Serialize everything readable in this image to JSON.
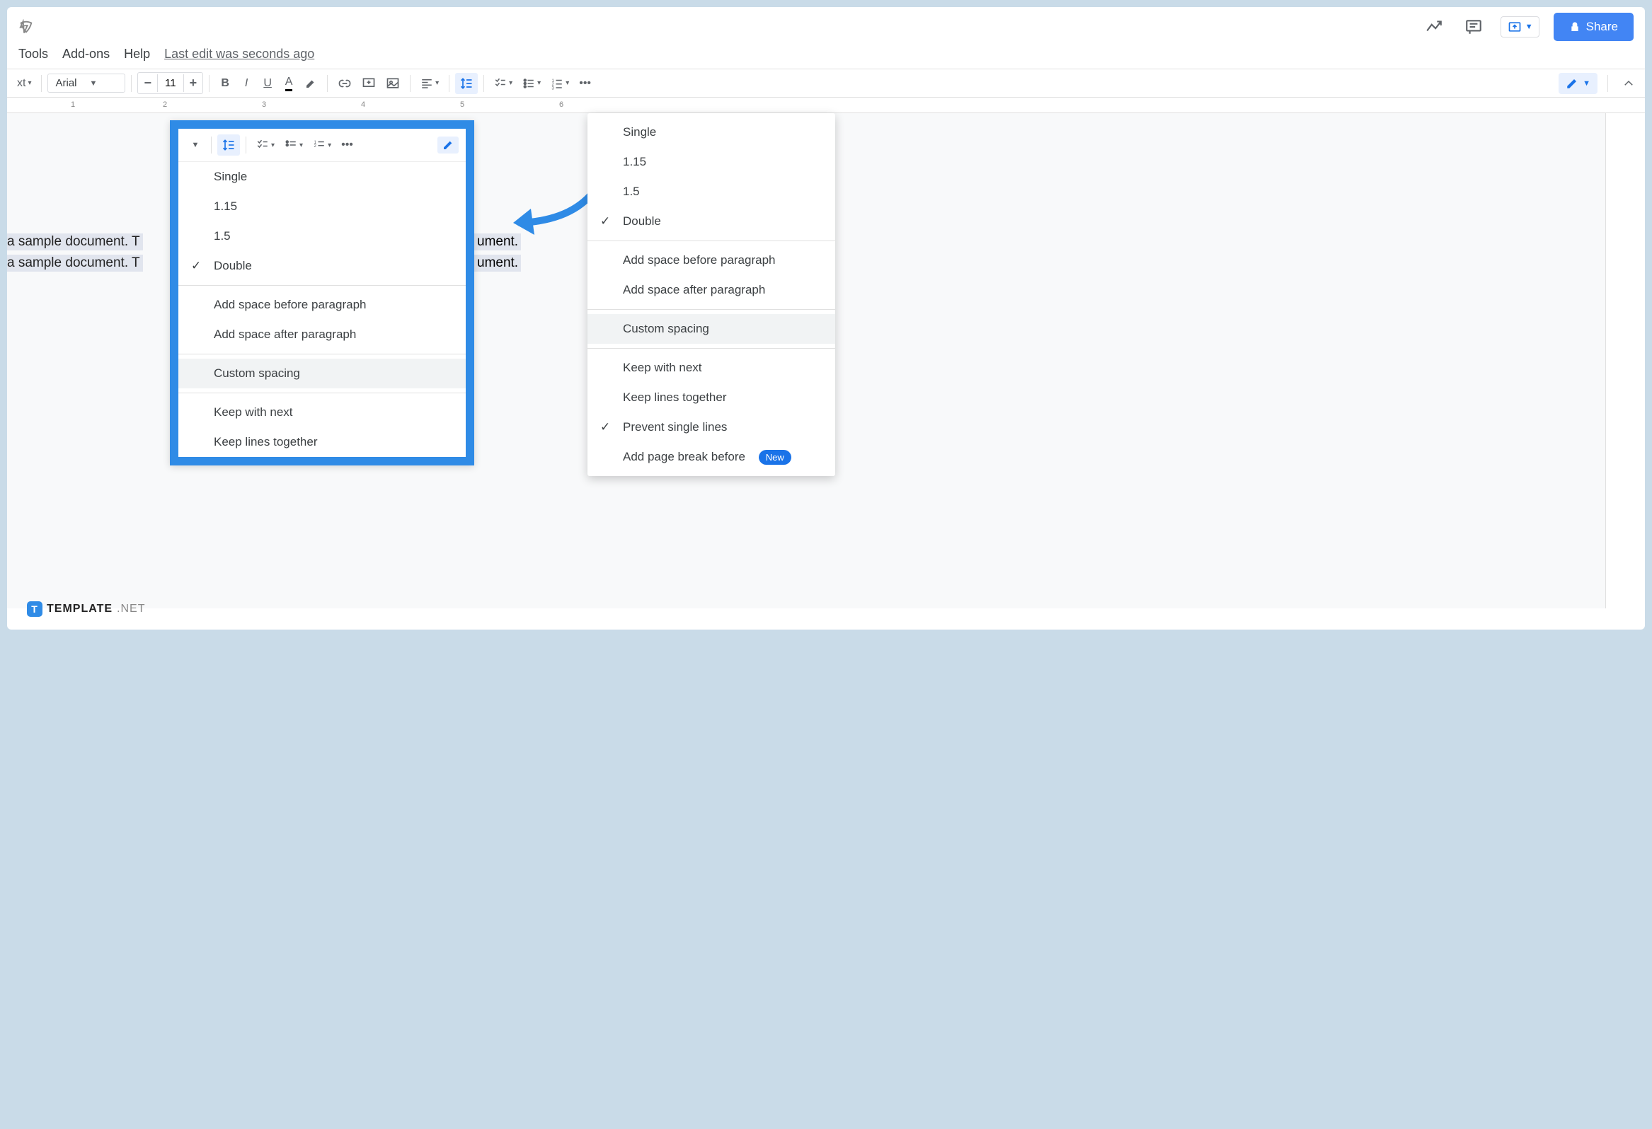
{
  "header": {
    "share_label": "Share"
  },
  "menu": {
    "tools": "Tools",
    "addons": "Add-ons",
    "help": "Help",
    "last_edit": "Last edit was seconds ago"
  },
  "toolbar": {
    "style": "xt",
    "font": "Arial",
    "font_size": "11"
  },
  "ruler": {
    "m1": "1",
    "m2": "2",
    "m3": "3",
    "m4": "4",
    "m5": "5",
    "m6": "6"
  },
  "doc": {
    "left_line1": "a sample document. T",
    "left_line2": "a sample document. T",
    "right_line1": "ument.",
    "right_line2": "ument."
  },
  "callout_menu": {
    "single": "Single",
    "v115": "1.15",
    "v15": "1.5",
    "double": "Double",
    "before": "Add space before paragraph",
    "after": "Add space after paragraph",
    "custom": "Custom spacing",
    "keep_next": "Keep with next",
    "keep_lines": "Keep lines together"
  },
  "main_menu": {
    "single": "Single",
    "v115": "1.15",
    "v15": "1.5",
    "double": "Double",
    "before": "Add space before paragraph",
    "after": "Add space after paragraph",
    "custom": "Custom spacing",
    "keep_next": "Keep with next",
    "keep_lines": "Keep lines together",
    "prevent_single": "Prevent single lines",
    "page_break": "Add page break before",
    "new_badge": "New"
  },
  "watermark": {
    "brand": "TEMPLATE",
    "net": ".NET"
  }
}
